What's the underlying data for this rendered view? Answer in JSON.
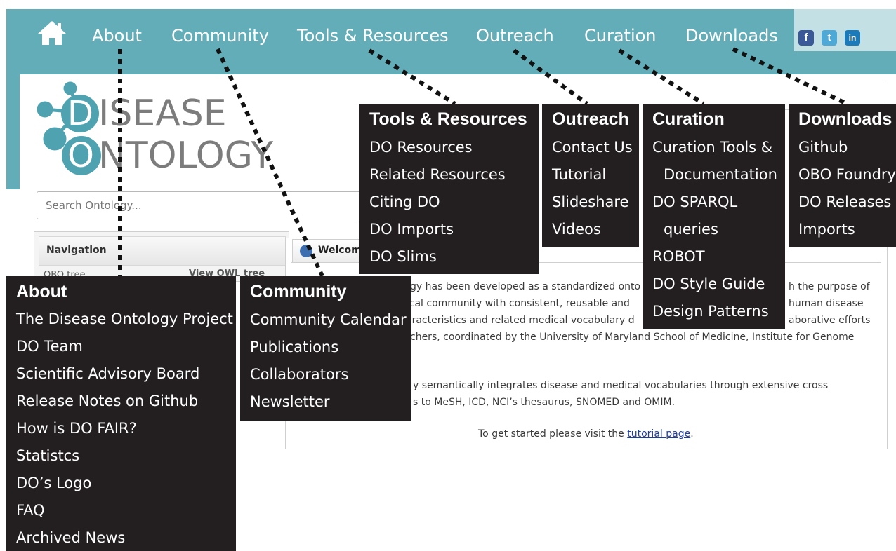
{
  "nav": {
    "home_icon": "home-icon",
    "items": [
      "About",
      "Community",
      "Tools & Resources",
      "Outreach",
      "Curation",
      "Downloads"
    ],
    "social": [
      "facebook-icon",
      "twitter-icon",
      "linkedin-icon"
    ],
    "social_glyphs": [
      "f",
      "t",
      "in"
    ],
    "color_bar": "#62adb8"
  },
  "logo": {
    "line1_initial": "D",
    "line1_rest": "ISEASE",
    "line2_initial": "O",
    "line2_rest": "NTOLOGY",
    "accent": "#4fa3b1"
  },
  "search": {
    "placeholder": "Search Ontology..."
  },
  "navigation_panel": {
    "title": "Navigation",
    "row_label": "OBO tree",
    "row_link": "View OWL tree"
  },
  "welcome": {
    "tab": "Welcome",
    "p1": [
      "gy has been developed as a standardized onto",
      "dical community with consistent, reusable and",
      "aracteristics and related medical vocabulary d",
      "chers, coordinated by the University of Maryland School of Medicine, Institute for Genome"
    ],
    "p1_right": [
      "h the purpose of",
      "human disease",
      "aborative efforts"
    ],
    "p2": [
      "y semantically integrates disease and medical vocabularies through extensive cross",
      "s to MeSH, ICD, NCI’s thesaurus, SNOMED and OMIM."
    ],
    "p3_prefix": "To get started please visit the",
    "p3_link": "tutorial page",
    "p3_suffix": "."
  },
  "menus": {
    "about": {
      "title": "About",
      "items": [
        "The Disease Ontology Project",
        "DO Team",
        "Scientific Advisory Board",
        "Release Notes on Github",
        "How is DO FAIR?",
        "Statistcs",
        "DO’s Logo",
        "FAQ",
        "Archived News"
      ]
    },
    "community": {
      "title": "Community",
      "items": [
        "Community Calendar",
        "Publications",
        "Collaborators",
        "Newsletter"
      ]
    },
    "tools": {
      "title": "Tools & Resources",
      "items": [
        "DO Resources",
        "Related Resources",
        "Citing DO",
        "DO Imports",
        "DO Slims"
      ]
    },
    "outreach": {
      "title": "Outreach",
      "items": [
        "Contact Us",
        "Tutorial",
        "Slideshare",
        "Videos"
      ]
    },
    "curation": {
      "title": "Curation",
      "items": [
        "Curation Tools &",
        "Documentation",
        "DO SPARQL",
        "queries",
        "ROBOT",
        "DO Style Guide",
        "Design Patterns"
      ]
    },
    "downloads": {
      "title": "Downloads",
      "items": [
        "Github",
        "OBO Foundry",
        "DO Releases",
        "Imports"
      ]
    }
  }
}
